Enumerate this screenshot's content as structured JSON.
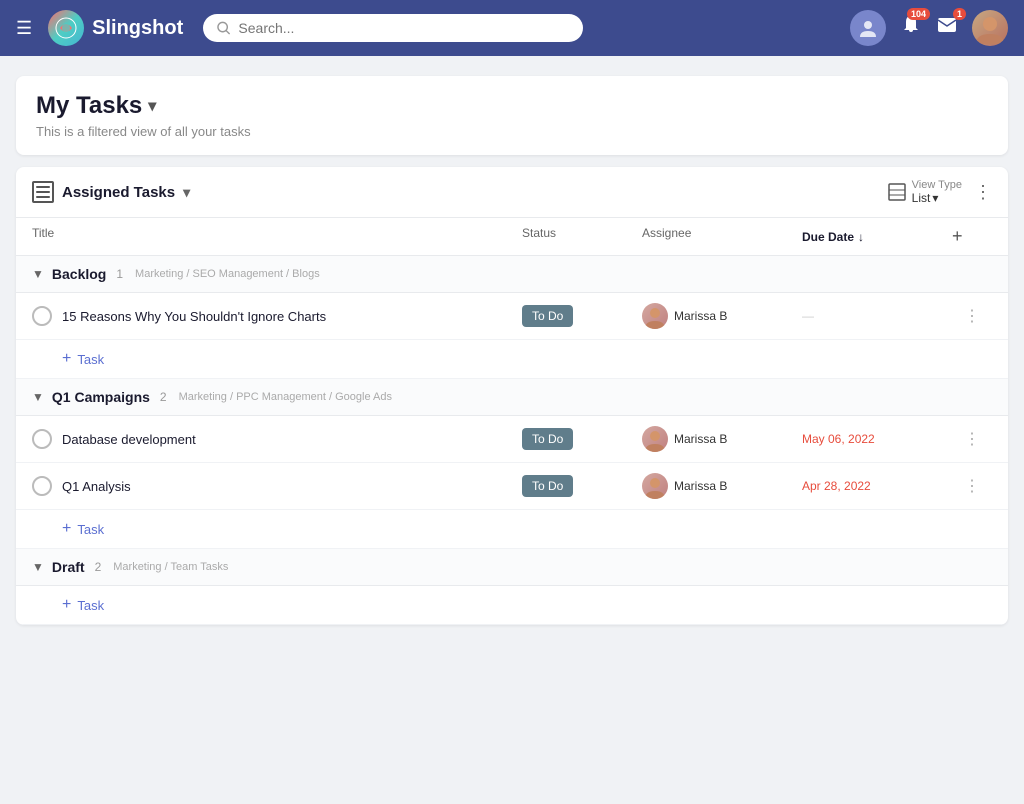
{
  "app": {
    "name": "Slingshot"
  },
  "header": {
    "search_placeholder": "Search...",
    "notification_count": "104",
    "message_count": "1"
  },
  "page": {
    "title": "My Tasks",
    "subtitle": "This is a filtered view of all your tasks"
  },
  "tasks_panel": {
    "section_title": "Assigned Tasks",
    "view_type_label": "View Type",
    "view_type_value": "List",
    "columns": {
      "title": "Title",
      "status": "Status",
      "assignee": "Assignee",
      "due_date": "Due Date",
      "due_date_sort": "↓"
    },
    "groups": [
      {
        "id": "backlog",
        "title": "Backlog",
        "count": "1",
        "path": "Marketing / SEO Management / Blogs",
        "tasks": [
          {
            "id": "task1",
            "title": "15 Reasons Why You Shouldn't Ignore Charts",
            "status": "To Do",
            "assignee": "Marissa B",
            "due_date": ""
          }
        ]
      },
      {
        "id": "q1campaigns",
        "title": "Q1 Campaigns",
        "count": "2",
        "path": "Marketing / PPC Management / Google Ads",
        "tasks": [
          {
            "id": "task2",
            "title": "Database development",
            "status": "To Do",
            "assignee": "Marissa B",
            "due_date": "May 06, 2022"
          },
          {
            "id": "task3",
            "title": "Q1 Analysis",
            "status": "To Do",
            "assignee": "Marissa B",
            "due_date": "Apr 28, 2022"
          }
        ]
      },
      {
        "id": "draft",
        "title": "Draft",
        "count": "2",
        "path": "Marketing / Team Tasks",
        "tasks": []
      }
    ],
    "add_task_label": "Task"
  }
}
